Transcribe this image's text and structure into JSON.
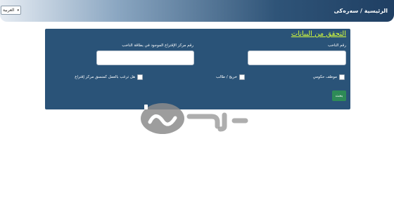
{
  "header": {
    "breadcrumb": "الرئيسية / سەرەكی",
    "language": "العربية"
  },
  "form": {
    "title": "التحقق من البيانات",
    "voter_number_label": "رقم الناخب",
    "voter_number_value": "",
    "station_label": "رقم مركز الإقتراع الموجود في بطاقة الناخب",
    "station_value": "",
    "options": {
      "gov_employee": "موظف حكومي",
      "graduate": "خريج / طالب",
      "coordinator": "هل ترغب بالعمل كمنسق مركز إقتراع"
    },
    "search_button": "بحث"
  },
  "colors": {
    "panel_bg": "#2a5378",
    "title_accent": "#d8ff3a",
    "button_bg": "#2e8b57"
  }
}
